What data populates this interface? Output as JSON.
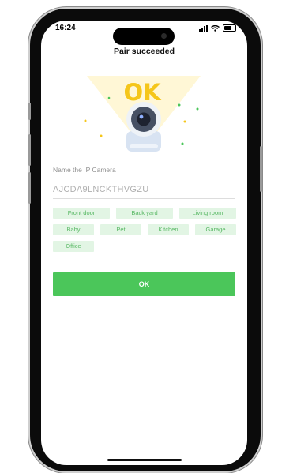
{
  "status_bar": {
    "time": "16:24",
    "icons": [
      "cellular-signal-icon",
      "wifi-icon",
      "battery-icon"
    ]
  },
  "header": {
    "title": "Pair succeeded"
  },
  "illustration": {
    "badge_text": "OK",
    "icon": "ip-camera-icon"
  },
  "form": {
    "name_label": "Name the IP Camera",
    "name_value": "AJCDA9LNCKTHVGZU"
  },
  "quick_names": [
    "Front door",
    "Back yard",
    "Living room",
    "Baby",
    "Pet",
    "Kitchen",
    "Garage",
    "Office"
  ],
  "actions": {
    "ok_label": "OK"
  },
  "colors": {
    "accent": "#4bc65a",
    "chip_bg": "#e2f5e4",
    "chip_text": "#58b864",
    "ok_badge": "#f5c61a"
  }
}
